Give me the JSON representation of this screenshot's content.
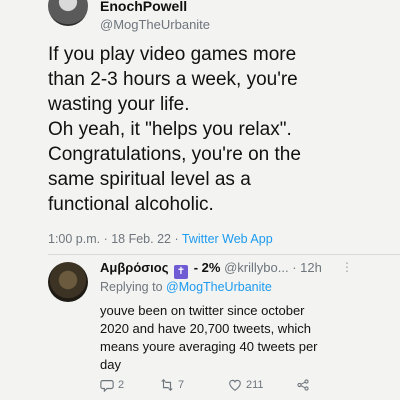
{
  "main_tweet": {
    "display_name": "EnochPowell",
    "handle": "@MogTheUrbanite",
    "text_lines": [
      "If you play video games more",
      "than 2-3 hours a week, you're",
      "wasting your life.",
      "Oh yeah, it \"helps you relax\".",
      "Congratulations, you're on the",
      "same spiritual level as a",
      "functional alcoholic."
    ],
    "timestamp": "1:00 p.m. · 18 Feb. 22 · ",
    "source_app": "Twitter Web App"
  },
  "reply": {
    "display_name": "Αμβρόσιος",
    "badge_glyph": "✝",
    "percent": "- 2%",
    "handle": "@krillybo...",
    "time": "· 12h",
    "menu": "⋮",
    "replying_prefix": "Replying to ",
    "replying_mention": "@MogTheUrbanite",
    "text_lines": [
      "youve been on twitter since october",
      "2020 and have 20,700 tweets, which",
      "means youre averaging 40 tweets per",
      "day"
    ],
    "actions": {
      "reply_count": "2",
      "retweet_count": "7",
      "like_count": "211"
    }
  },
  "colors": {
    "background": "#f3f3f1",
    "link_blue": "#1d9bf0",
    "secondary_text": "#6e767d",
    "badge_purple": "#6f5bd3"
  }
}
